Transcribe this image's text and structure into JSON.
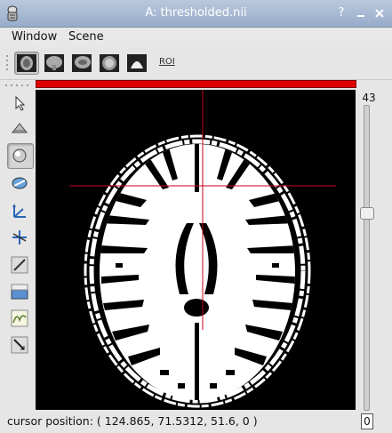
{
  "window": {
    "title": "A: thresholded.nii"
  },
  "menubar": {
    "items": [
      "Window",
      "Scene"
    ]
  },
  "toolbar": {
    "roi_label": "ROI"
  },
  "slider": {
    "top_value": "43",
    "field_value": "0"
  },
  "status": {
    "cursor_text": "cursor position: ( 124.865, 71.5312, 51.6, 0 )"
  },
  "colors": {
    "crosshair": "#c8001c",
    "slice_bar": "#e00000"
  },
  "icons": {
    "toolbar": [
      "axial-view-icon",
      "coronal-view-icon",
      "sagittal-view-icon",
      "oblique-view-icon",
      "volume-render-icon"
    ],
    "tools": [
      "pointer-icon",
      "plane-icon",
      "trackball-icon",
      "rotate-icon",
      "axes-icon",
      "move-icon",
      "draw-icon",
      "level-icon",
      "segment-icon",
      "ruler-icon"
    ]
  }
}
